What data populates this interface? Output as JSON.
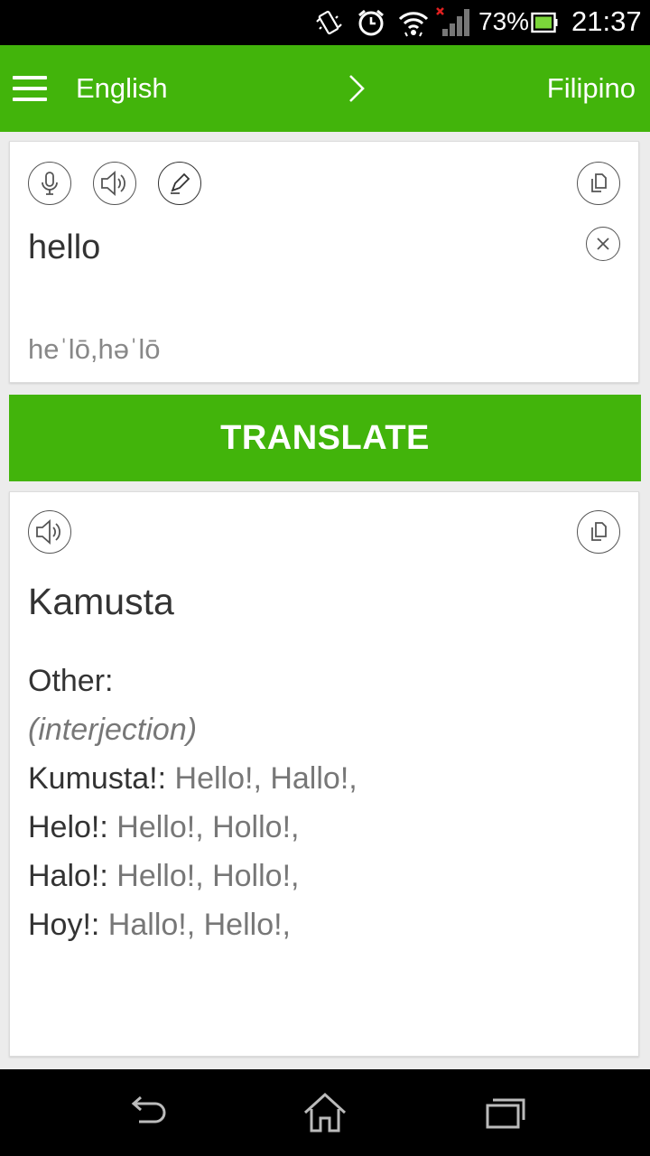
{
  "status_bar": {
    "battery_percent": "73%",
    "time": "21:37",
    "icons": [
      "vibrate-icon",
      "alarm-icon",
      "wifi-icon",
      "signal-icon",
      "battery-icon"
    ]
  },
  "app_bar": {
    "source_language": "English",
    "target_language": "Filipino",
    "icons": [
      "menu-icon",
      "chevron-right-icon"
    ]
  },
  "input": {
    "text": "hello",
    "phonetic": "heˈlō,həˈlō",
    "icons": [
      "microphone-icon",
      "speaker-icon",
      "pen-icon",
      "copy-icon",
      "clear-icon"
    ]
  },
  "translate_button": {
    "label": "TRANSLATE"
  },
  "output": {
    "translation": "Kamusta",
    "other_label": "Other:",
    "part_of_speech": "(interjection)",
    "alternatives": [
      {
        "word": "Kumusta!:",
        "translations": " Hello!, Hallo!,"
      },
      {
        "word": "Helo!:",
        "translations": " Hello!, Hollo!,"
      },
      {
        "word": "Halo!:",
        "translations": " Hello!, Hollo!,"
      },
      {
        "word": "Hoy!:",
        "translations": " Hallo!, Hello!,"
      }
    ],
    "icons": [
      "speaker-icon",
      "copy-icon"
    ]
  },
  "nav_bar": {
    "icons": [
      "back-icon",
      "home-icon",
      "recent-apps-icon"
    ]
  },
  "colors": {
    "accent": "#42b40b",
    "status_bar": "#000000",
    "background": "#ececec"
  }
}
